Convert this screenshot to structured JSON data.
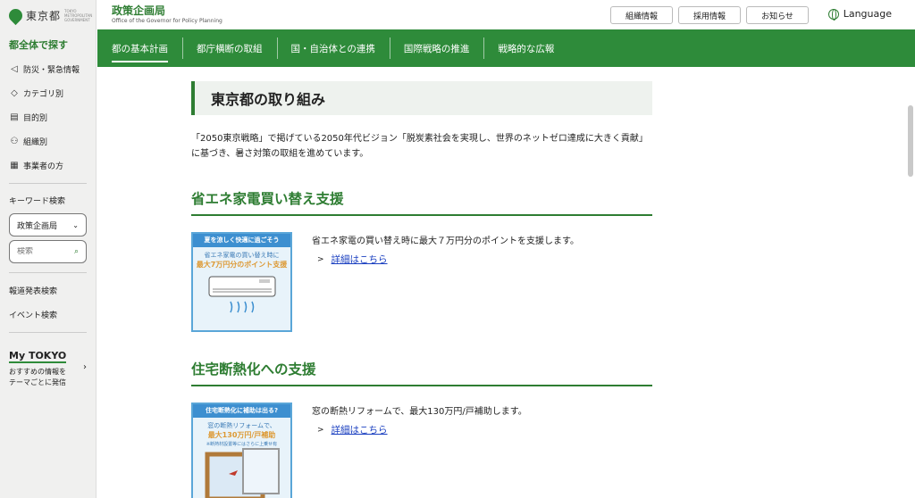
{
  "sidebar": {
    "logo_text": "東京都",
    "logo_sub": "TOKYO METROPOLITAN GOVERNMENT",
    "heading": "都全体で探す",
    "items": [
      {
        "label": "防災・緊急情報",
        "icon": "megaphone-icon",
        "glyph": "◁"
      },
      {
        "label": "カテゴリ別",
        "icon": "tag-icon",
        "glyph": "◇"
      },
      {
        "label": "目的別",
        "icon": "document-icon",
        "glyph": "▤"
      },
      {
        "label": "組織別",
        "icon": "org-chart-icon",
        "glyph": "⚇"
      },
      {
        "label": "事業者の方",
        "icon": "business-icon",
        "glyph": "▦"
      }
    ],
    "keyword_label": "キーワード検索",
    "select_value": "政策企画局",
    "search_placeholder": "検索",
    "press_search": "報道発表検索",
    "event_search": "イベント検索",
    "mytokyo_title": "My TOKYO",
    "mytokyo_desc_1": "おすすめの情報を",
    "mytokyo_desc_2": "テーマごとに発信"
  },
  "header": {
    "dept_name": "政策企画局",
    "dept_en": "Office of the Governor for Policy Planning",
    "buttons": [
      "組織情報",
      "採用情報",
      "お知らせ"
    ],
    "language": "Language"
  },
  "nav": {
    "items": [
      "都の基本計画",
      "都庁横断の取組",
      "国・自治体との連携",
      "国際戦略の推進",
      "戦略的な広報"
    ]
  },
  "main": {
    "title": "東京都の取り組み",
    "lead": "「2050東京戦略」で掲げている2050年代ビジョン「脱炭素社会を実現し、世界のネットゼロ達成に大きく貢献」に基づき、暑さ対策の取組を進めています。",
    "sections": [
      {
        "heading": "省エネ家電買い替え支援",
        "desc": "省エネ家電の買い替え時に最大７万円分のポイントを支援します。",
        "link": "詳細はこちら",
        "promo_top": "夏を涼しく快適に過ごそう",
        "promo_line1": "省エネ家電の買い替え時に",
        "promo_big": "最大7万円分のポイント支援"
      },
      {
        "heading": "住宅断熱化への支援",
        "desc": "窓の断熱リフォームで、最大130万円/戸補助します。",
        "link": "詳細はこちら",
        "promo_top": "住宅断熱化に補助は出る?",
        "promo_line1": "窓の断熱リフォームで、",
        "promo_big": "最大130万円/戸補助",
        "promo_note": "※断熱材設置等にはさらに上乗せ有"
      }
    ]
  },
  "colors": {
    "brand_green": "#2e8b3a",
    "link_blue": "#1a3fc0",
    "promo_blue": "#3d8fd0"
  }
}
